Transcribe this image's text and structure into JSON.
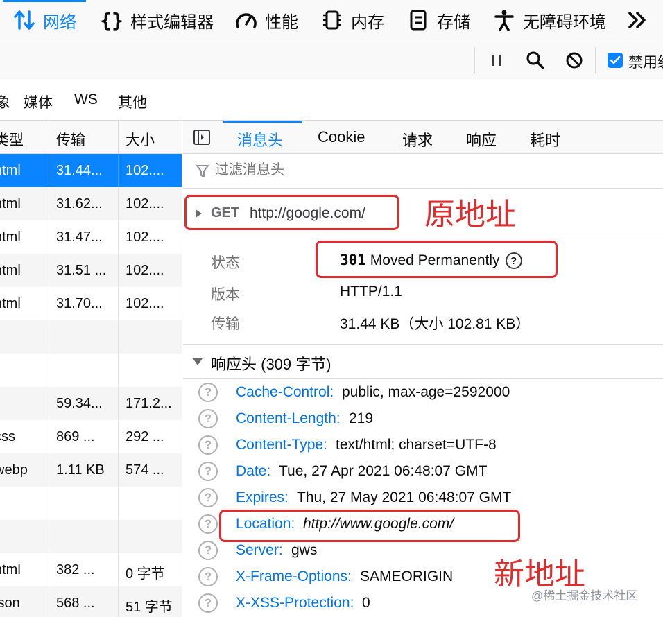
{
  "toolbar": {
    "tabs": [
      {
        "label": "网络",
        "icon": "network-arrows-icon",
        "active": true
      },
      {
        "label": "样式编辑器",
        "icon": "braces-icon"
      },
      {
        "label": "性能",
        "icon": "gauge-icon"
      },
      {
        "label": "内存",
        "icon": "memory-chip-icon"
      },
      {
        "label": "存储",
        "icon": "storage-icon"
      },
      {
        "label": "无障碍环境",
        "icon": "accessibility-person-icon"
      }
    ],
    "overflow_icon": "double-chevron-right-icon"
  },
  "actions": {
    "pause_icon": "pause-icon",
    "search_icon": "search-icon",
    "block_icon": "block-icon",
    "disable_cache_label": "禁用缓",
    "disable_cache_checked": true
  },
  "type_filters": [
    "象",
    "媒体",
    "WS",
    "其他"
  ],
  "request_list": {
    "columns": [
      "类型",
      "传输",
      "大小"
    ],
    "rows": [
      {
        "type": "html",
        "transferred": "31.44...",
        "size": "102....",
        "selected": true
      },
      {
        "type": "html",
        "transferred": "31.62...",
        "size": "102...."
      },
      {
        "type": "html",
        "transferred": "31.47...",
        "size": "102...."
      },
      {
        "type": "html",
        "transferred": "31.51 ...",
        "size": "102...."
      },
      {
        "type": "html",
        "transferred": "31.70...",
        "size": "102...."
      },
      {
        "type": "",
        "transferred": "",
        "size": ""
      },
      {
        "type": "",
        "transferred": "",
        "size": ""
      },
      {
        "type": "",
        "transferred": "59.34...",
        "size": "171.2..."
      },
      {
        "type": "css",
        "transferred": "869 ...",
        "size": "292 ..."
      },
      {
        "type": "webp",
        "transferred": "1.11 KB",
        "size": "574 ..."
      },
      {
        "type": "",
        "transferred": "",
        "size": ""
      },
      {
        "type": "",
        "transferred": "",
        "size": ""
      },
      {
        "type": "html",
        "transferred": "382 ...",
        "size": "0 字节"
      },
      {
        "type": "json",
        "transferred": "568 ...",
        "size": "51 字节"
      }
    ]
  },
  "details": {
    "tabs": [
      "消息头",
      "Cookie",
      "请求",
      "响应",
      "耗时"
    ],
    "active_tab": "消息头",
    "filter_placeholder": "过滤消息头",
    "request": {
      "method": "GET",
      "url": "http://google.com/"
    },
    "summary": [
      {
        "label": "状态",
        "code": "301",
        "text": "Moved Permanently"
      },
      {
        "label": "版本",
        "value": "HTTP/1.1"
      },
      {
        "label": "传输",
        "value": "31.44 KB（大小 102.81 KB）"
      }
    ],
    "response_headers_title": "响应头 (309 字节)",
    "response_headers": [
      {
        "name": "Cache-Control:",
        "value": "public, max-age=2592000"
      },
      {
        "name": "Content-Length:",
        "value": "219"
      },
      {
        "name": "Content-Type:",
        "value": "text/html; charset=UTF-8"
      },
      {
        "name": "Date:",
        "value": "Tue, 27 Apr 2021 06:48:07 GMT"
      },
      {
        "name": "Expires:",
        "value": "Thu, 27 May 2021 06:48:07 GMT"
      },
      {
        "name": "Location:",
        "value": "http://www.google.com/",
        "italic": true
      },
      {
        "name": "Server:",
        "value": "gws"
      },
      {
        "name": "X-Frame-Options:",
        "value": "SAMEORIGIN"
      },
      {
        "name": "X-XSS-Protection:",
        "value": "0"
      }
    ]
  },
  "annotations": {
    "original_label": "原地址",
    "new_label": "新地址",
    "color": "#e02c2c"
  },
  "watermark": "@稀土掘金技术社区",
  "colors": {
    "accent": "#0a84ff",
    "header_name": "#0074e8"
  }
}
